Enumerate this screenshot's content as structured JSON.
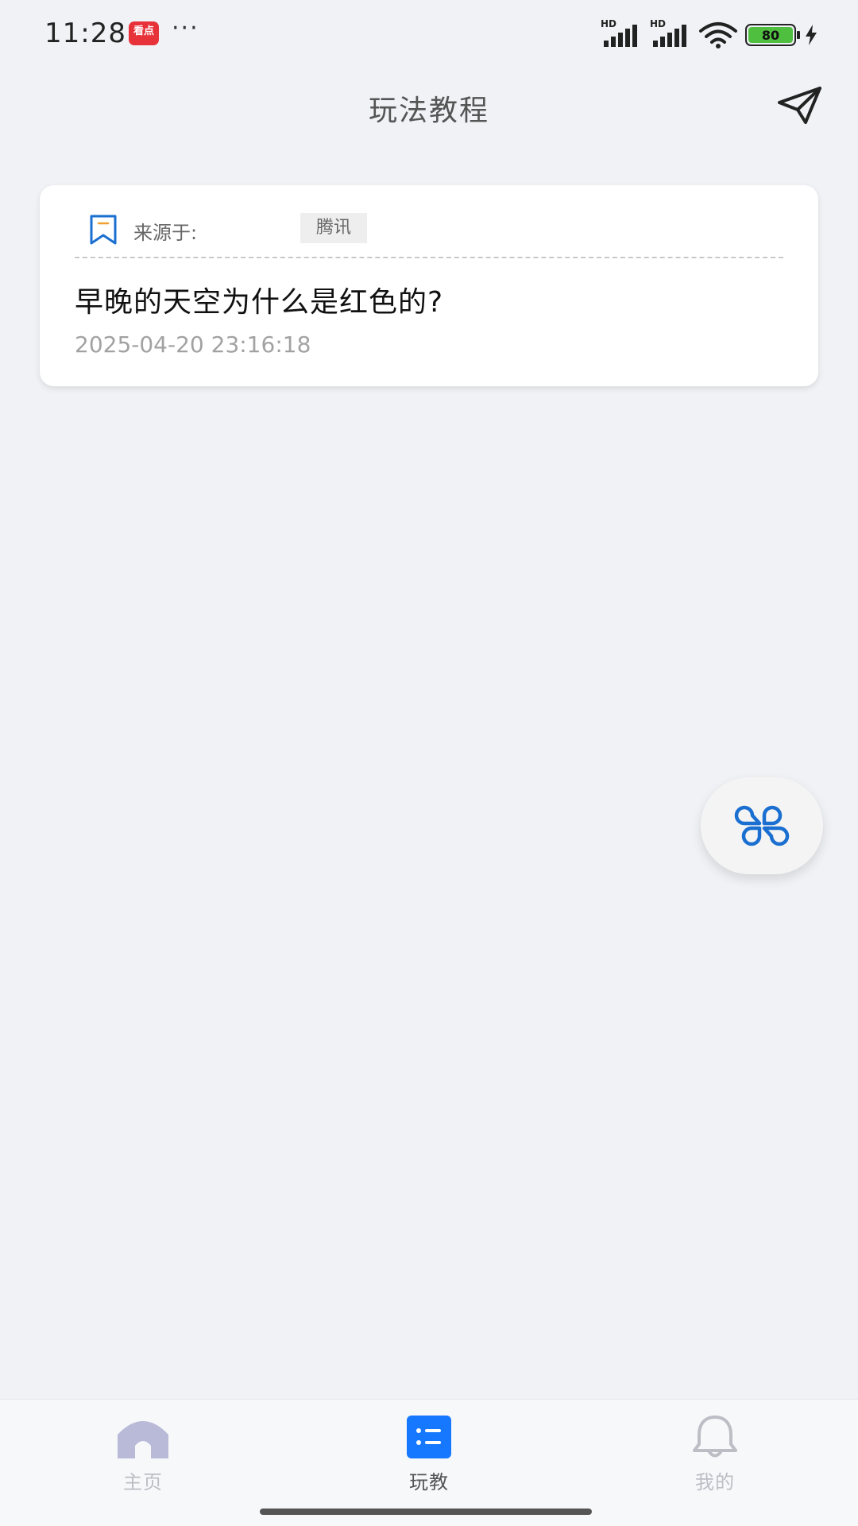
{
  "status_bar": {
    "time": "11:28",
    "app_badge": "看点",
    "dots": "···",
    "network_1": "HD",
    "network_2": "HD",
    "battery": "80"
  },
  "header": {
    "title": "玩法教程"
  },
  "card": {
    "source_label": "来源于:",
    "source_tag": "腾讯",
    "title": "早晚的天空为什么是红色的?",
    "time": "2025-04-20 23:16:18"
  },
  "bottom_nav": {
    "items": [
      {
        "label": "主页",
        "icon": "home-icon",
        "active": false
      },
      {
        "label": "玩教",
        "icon": "list-icon",
        "active": true
      },
      {
        "label": "我的",
        "icon": "bell-icon",
        "active": false
      }
    ]
  },
  "colors": {
    "background": "#f0f2f6",
    "accent_blue": "#1677ff",
    "icon_blue": "#1a6fd0",
    "inactive_nav": "#bdbdc5"
  }
}
